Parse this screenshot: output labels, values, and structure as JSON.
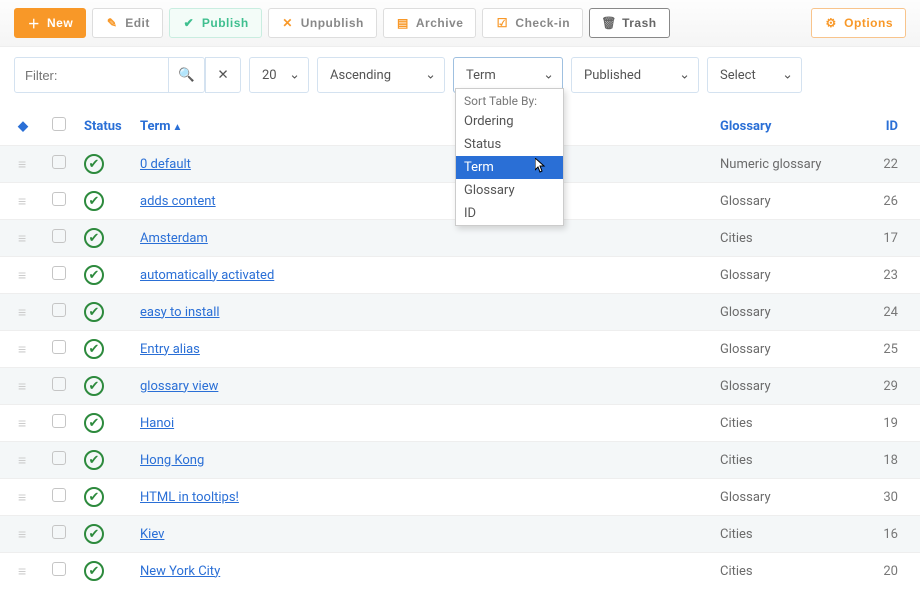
{
  "toolbar": {
    "new": "New",
    "edit": "Edit",
    "publish": "Publish",
    "unpublish": "Unpublish",
    "archive": "Archive",
    "checkin": "Check-in",
    "trash": "Trash",
    "options": "Options"
  },
  "filter": {
    "placeholder": "Filter:",
    "page_size": "20",
    "direction": "Ascending",
    "sort_column": "Term",
    "state": "Published",
    "glossary_filter": "Select"
  },
  "dropdown": {
    "header": "Sort Table By:",
    "options": [
      "Ordering",
      "Status",
      "Term",
      "Glossary",
      "ID"
    ],
    "selected": "Term"
  },
  "columns": {
    "status": "Status",
    "term": "Term",
    "glossary": "Glossary",
    "id": "ID"
  },
  "rows": [
    {
      "term": "0 default",
      "glossary": "Numeric glossary",
      "id": "22"
    },
    {
      "term": "adds content",
      "glossary": "Glossary",
      "id": "26"
    },
    {
      "term": "Amsterdam",
      "glossary": "Cities",
      "id": "17"
    },
    {
      "term": "automatically activated",
      "glossary": "Glossary",
      "id": "23"
    },
    {
      "term": "easy to install",
      "glossary": "Glossary",
      "id": "24"
    },
    {
      "term": "Entry alias",
      "glossary": "Glossary",
      "id": "25"
    },
    {
      "term": "glossary view",
      "glossary": "Glossary",
      "id": "29"
    },
    {
      "term": "Hanoi",
      "glossary": "Cities",
      "id": "19"
    },
    {
      "term": "Hong Kong",
      "glossary": "Cities",
      "id": "18"
    },
    {
      "term": "HTML in tooltips!",
      "glossary": "Glossary",
      "id": "30"
    },
    {
      "term": "Kiev",
      "glossary": "Cities",
      "id": "16"
    },
    {
      "term": "New York City",
      "glossary": "Cities",
      "id": "20"
    }
  ]
}
